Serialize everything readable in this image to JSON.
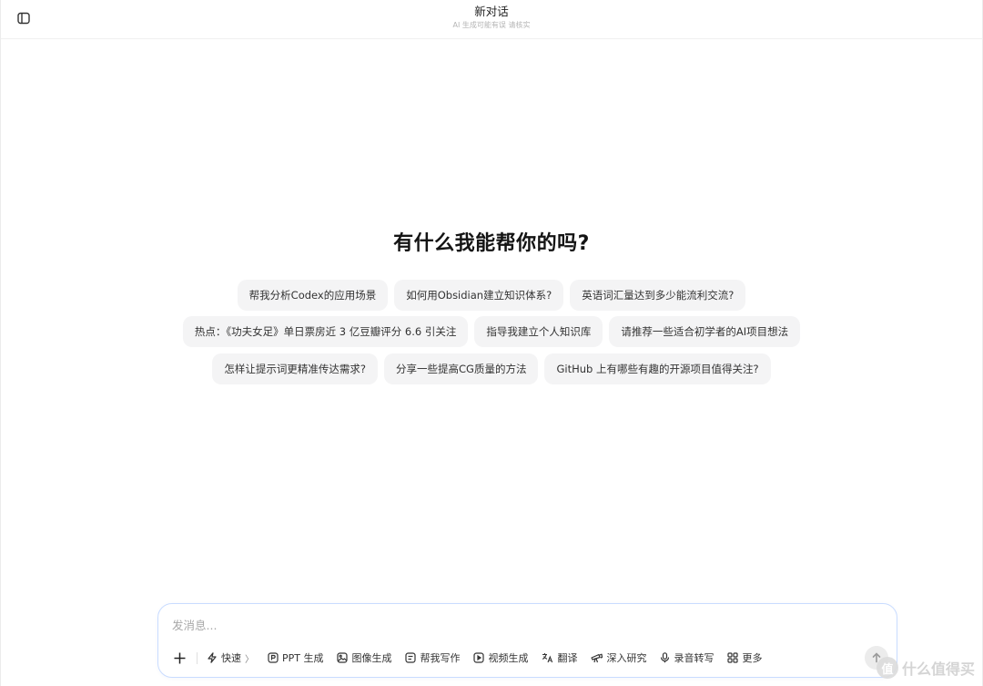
{
  "header": {
    "title": "新对话",
    "subtitle": "AI 生成可能有误 请核实"
  },
  "greeting": "有什么我能帮你的吗?",
  "suggestions": {
    "row1": [
      "帮我分析Codex的应用场景",
      "如何用Obsidian建立知识体系?",
      "英语词汇量达到多少能流利交流?"
    ],
    "row2": [
      "热点：《功夫女足》单日票房近 3 亿豆瓣评分 6.6 引关注",
      "指导我建立个人知识库",
      "请推荐一些适合初学者的AI项目想法"
    ],
    "row3": [
      "怎样让提示词更精准传达需求?",
      "分享一些提高CG质量的方法",
      "GitHub 上有哪些有趣的开源项目值得关注?"
    ]
  },
  "composer": {
    "placeholder": "发消息...",
    "value": "",
    "tools": [
      {
        "icon": "lightning-icon",
        "label": "快速",
        "has_chevron": true
      },
      {
        "icon": "ppt-icon",
        "label": "PPT 生成"
      },
      {
        "icon": "image-icon",
        "label": "图像生成"
      },
      {
        "icon": "writing-icon",
        "label": "帮我写作"
      },
      {
        "icon": "video-icon",
        "label": "视频生成"
      },
      {
        "icon": "translate-icon",
        "label": "翻译"
      },
      {
        "icon": "research-icon",
        "label": "深入研究"
      },
      {
        "icon": "microphone-icon",
        "label": "录音转写"
      },
      {
        "icon": "grid-icon",
        "label": "更多"
      }
    ],
    "chevron": "〉"
  },
  "watermark": {
    "logo": "值",
    "text": "什么值得买"
  }
}
